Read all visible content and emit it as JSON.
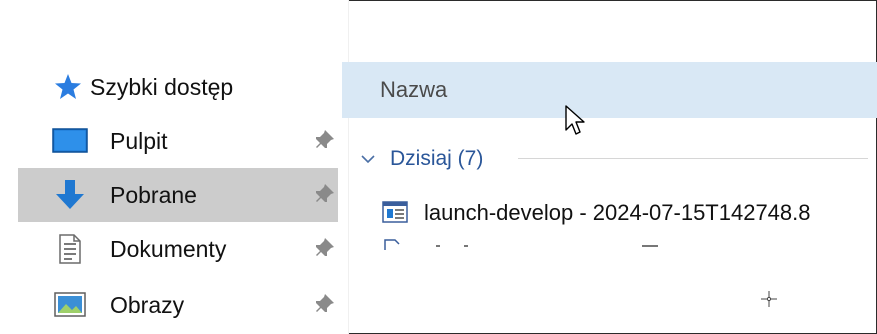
{
  "sidebar": {
    "items": [
      {
        "label": "Szybki dostęp",
        "icon": "star-icon",
        "pinned": false,
        "selected": false
      },
      {
        "label": "Pulpit",
        "icon": "desktop-icon",
        "pinned": true,
        "selected": false
      },
      {
        "label": "Pobrane",
        "icon": "download-arrow-icon",
        "pinned": true,
        "selected": true
      },
      {
        "label": "Dokumenty",
        "icon": "document-icon",
        "pinned": true,
        "selected": false
      },
      {
        "label": "Obrazy",
        "icon": "pictures-icon",
        "pinned": true,
        "selected": false
      }
    ]
  },
  "columns": {
    "name_header": "Nazwa"
  },
  "group": {
    "label": "Dzisiaj (7)"
  },
  "files": [
    {
      "name": "launch-develop - 2024-07-15T142748.8",
      "icon": "log-file-icon"
    }
  ],
  "colors": {
    "header_band": "#d9e8f5",
    "selected_item": "#cccccc",
    "group_label": "#2a5699",
    "accent_blue": "#1f78d1"
  }
}
